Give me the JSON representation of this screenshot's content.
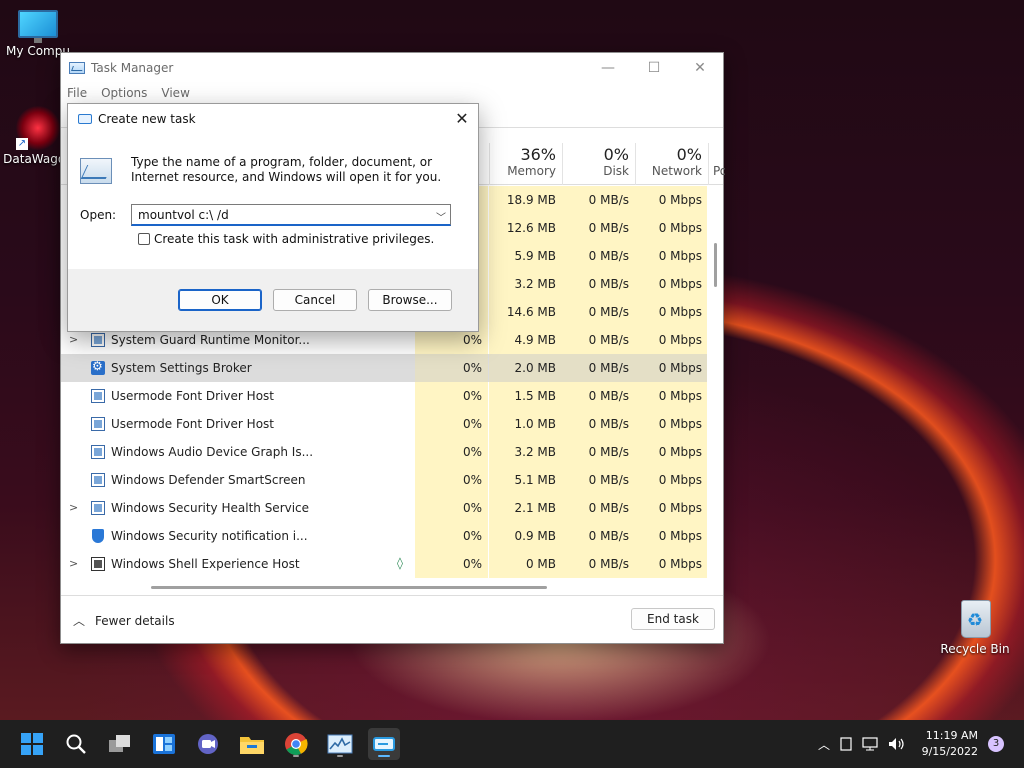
{
  "desktop": {
    "icons": [
      {
        "label": "My Compu"
      },
      {
        "label": "DataWagon"
      },
      {
        "label": "Recycle Bin"
      }
    ]
  },
  "task_manager": {
    "title": "Task Manager",
    "menu": [
      "File",
      "Options",
      "View"
    ],
    "columns": {
      "memory": {
        "pct": "36%",
        "name": "Memory"
      },
      "disk": {
        "pct": "0%",
        "name": "Disk"
      },
      "network": {
        "pct": "0%",
        "name": "Network"
      },
      "power": {
        "name": "Po"
      }
    },
    "rows": [
      {
        "name": "",
        "cpu": "",
        "memory": "18.9 MB",
        "disk": "0 MB/s",
        "network": "0 Mbps"
      },
      {
        "name": "",
        "cpu": "",
        "memory": "12.6 MB",
        "disk": "0 MB/s",
        "network": "0 Mbps"
      },
      {
        "name": "",
        "cpu": "",
        "memory": "5.9 MB",
        "disk": "0 MB/s",
        "network": "0 Mbps"
      },
      {
        "name": "",
        "cpu": "",
        "memory": "3.2 MB",
        "disk": "0 MB/s",
        "network": "0 Mbps"
      },
      {
        "name": "",
        "cpu": "",
        "memory": "14.6 MB",
        "disk": "0 MB/s",
        "network": "0 Mbps"
      },
      {
        "name": "System Guard Runtime Monitor...",
        "cpu": "0%",
        "memory": "4.9 MB",
        "disk": "0 MB/s",
        "network": "0 Mbps"
      },
      {
        "name": "System Settings Broker",
        "cpu": "0%",
        "memory": "2.0 MB",
        "disk": "0 MB/s",
        "network": "0 Mbps"
      },
      {
        "name": "Usermode Font Driver Host",
        "cpu": "0%",
        "memory": "1.5 MB",
        "disk": "0 MB/s",
        "network": "0 Mbps"
      },
      {
        "name": "Usermode Font Driver Host",
        "cpu": "0%",
        "memory": "1.0 MB",
        "disk": "0 MB/s",
        "network": "0 Mbps"
      },
      {
        "name": "Windows Audio Device Graph Is...",
        "cpu": "0%",
        "memory": "3.2 MB",
        "disk": "0 MB/s",
        "network": "0 Mbps"
      },
      {
        "name": "Windows Defender SmartScreen",
        "cpu": "0%",
        "memory": "5.1 MB",
        "disk": "0 MB/s",
        "network": "0 Mbps"
      },
      {
        "name": "Windows Security Health Service",
        "cpu": "0%",
        "memory": "2.1 MB",
        "disk": "0 MB/s",
        "network": "0 Mbps"
      },
      {
        "name": "Windows Security notification i...",
        "cpu": "0%",
        "memory": "0.9 MB",
        "disk": "0 MB/s",
        "network": "0 Mbps"
      },
      {
        "name": "Windows Shell Experience Host",
        "cpu": "0%",
        "memory": "0 MB",
        "disk": "0 MB/s",
        "network": "0 Mbps"
      }
    ],
    "fewer_details": "Fewer details",
    "end_task": "End task"
  },
  "run_dialog": {
    "title": "Create new task",
    "description": "Type the name of a program, folder, document, or Internet resource, and Windows will open it for you.",
    "open_label": "Open:",
    "input_value": "mountvol c:\\ /d",
    "admin_checkbox": "Create this task with administrative privileges.",
    "ok": "OK",
    "cancel": "Cancel",
    "browse": "Browse..."
  },
  "taskbar": {
    "time": "11:19 AM",
    "date": "9/15/2022",
    "notifications": "3"
  }
}
